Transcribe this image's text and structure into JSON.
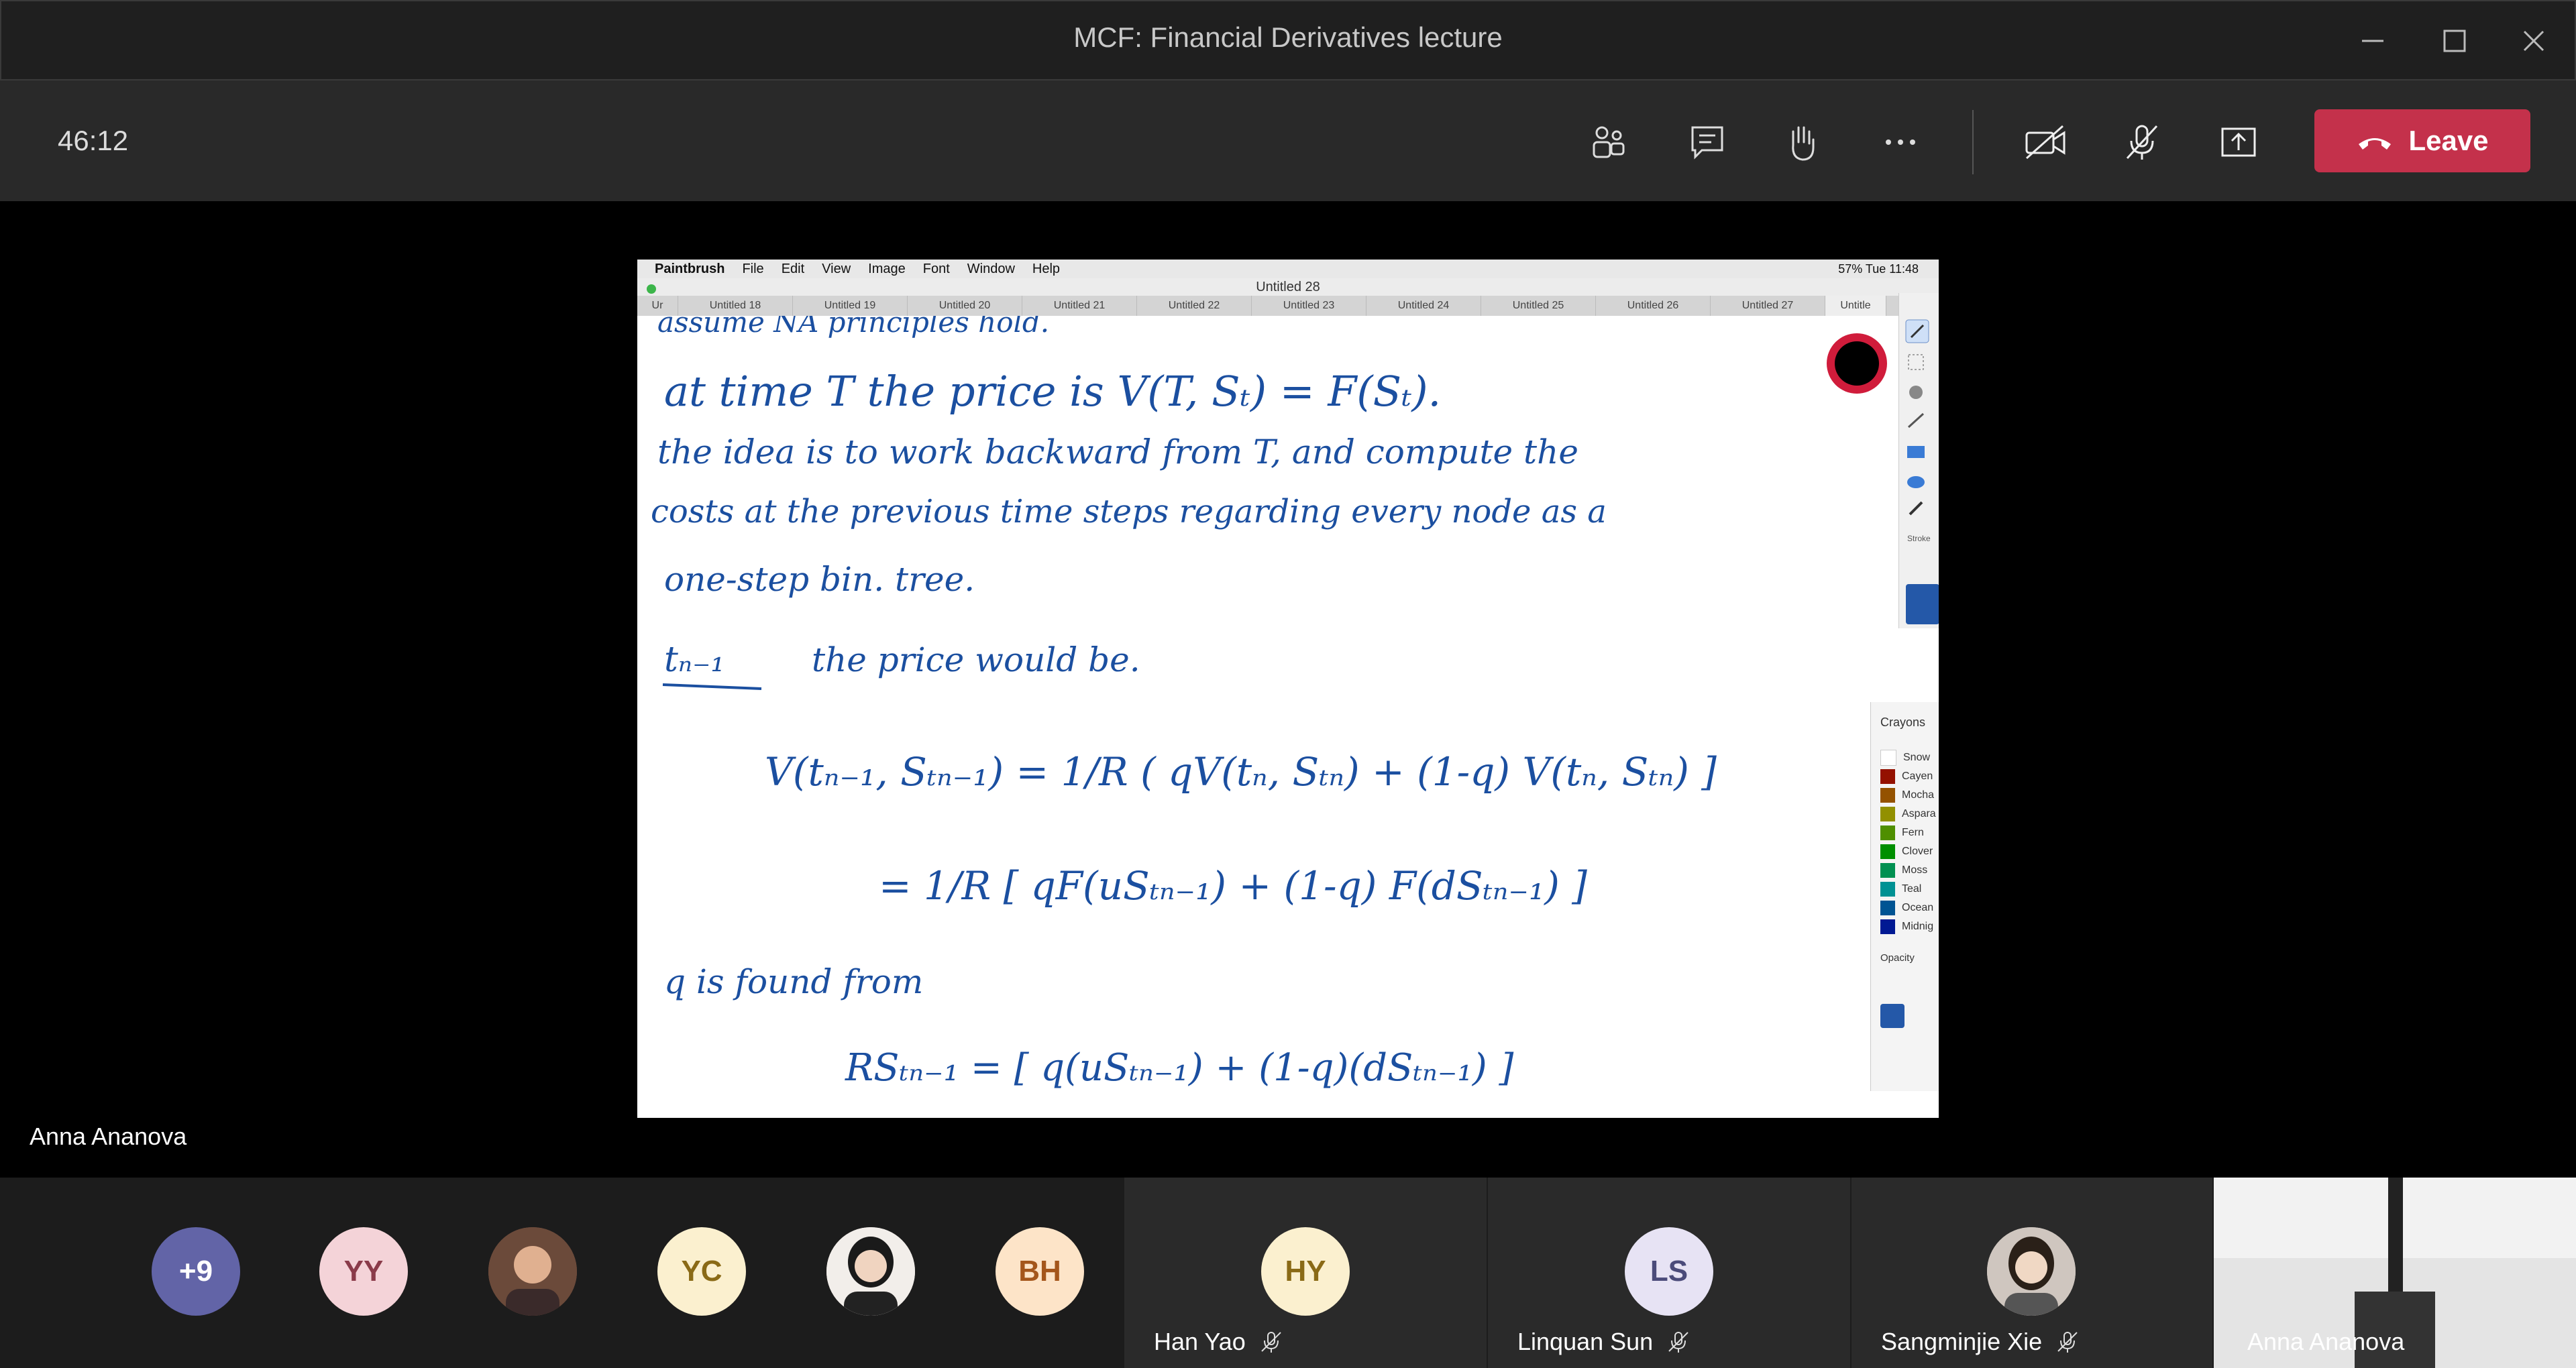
{
  "window": {
    "title": "MCF: Financial Derivatives lecture"
  },
  "toolbar": {
    "timer": "46:12",
    "leave_label": "Leave"
  },
  "presenter": {
    "name": "Anna Ananova"
  },
  "paintbrush": {
    "menu": [
      "Paintbrush",
      "File",
      "Edit",
      "View",
      "Image",
      "Font",
      "Window",
      "Help"
    ],
    "status": "57%  Tue 11:48",
    "doc_title": "Untitled 28",
    "tabs": [
      "Ur",
      "Untitled 18",
      "Untitled 19",
      "Untitled 20",
      "Untitled 21",
      "Untitled 22",
      "Untitled 23",
      "Untitled 24",
      "Untitled 25",
      "Untitled 26",
      "Untitled 27",
      "Untitle"
    ],
    "stroke_label": "Stroke",
    "crayons_label": "Crayons",
    "opacity_label": "Opacity",
    "crayons": [
      {
        "name": "Snow",
        "color": "#ffffff"
      },
      {
        "name": "Cayen",
        "color": "#941100"
      },
      {
        "name": "Mocha",
        "color": "#945200"
      },
      {
        "name": "Aspara",
        "color": "#929000"
      },
      {
        "name": "Fern",
        "color": "#4f8f00"
      },
      {
        "name": "Clover",
        "color": "#008f00"
      },
      {
        "name": "Moss",
        "color": "#009051"
      },
      {
        "name": "Teal",
        "color": "#009193"
      },
      {
        "name": "Ocean",
        "color": "#005493"
      },
      {
        "name": "Midnig",
        "color": "#011993"
      }
    ],
    "handwriting": {
      "l1": "assume NA principles hold.",
      "l2": "at time T the price is V(T, Sₜ) = F(Sₜ).",
      "l3": "the idea is to work backward from T, and compute the",
      "l4": "costs at the previous time steps regarding every node as a",
      "l5": "one-step bin. tree.",
      "l6a": "tₙ₋₁",
      "l6b": "the price would be.",
      "l7": "V(tₙ₋₁, Sₜₙ₋₁) =  1/R ( qV(tₙ, Sₜₙ) + (1-q)  V(tₙ, Sₜₙ) ]",
      "l8": "=  1/R [ qF(uSₜₙ₋₁) + (1-q) F(dSₜₙ₋₁) ]",
      "l9": "q is found from",
      "l10": "RSₜₙ₋₁ = [ q(uSₜₙ₋₁) + (1-q)(dSₜₙ₋₁) ]"
    }
  },
  "participants": [
    {
      "initials": "+9",
      "bg": "#6264a7",
      "fg": "#ffffff"
    },
    {
      "initials": "YY",
      "bg": "#f4d3d8",
      "fg": "#8a3b4a"
    },
    {
      "initials": "",
      "bg": "#8a5a4a",
      "fg": "#ffffff"
    },
    {
      "initials": "YC",
      "bg": "#fbf0cf",
      "fg": "#8a6a16"
    },
    {
      "initials": "",
      "bg": "#e8e0dc",
      "fg": "#ffffff"
    },
    {
      "initials": "BH",
      "bg": "#fde4c8",
      "fg": "#a4561b"
    }
  ],
  "tiles": [
    {
      "initials": "HY",
      "name": "Han Yao",
      "bg": "#fbf0cf",
      "fg": "#8a6a16"
    },
    {
      "initials": "LS",
      "name": "Linquan Sun",
      "bg": "#e7e3f4",
      "fg": "#4b4b7a"
    },
    {
      "initials": "",
      "name": "Sangminjie Xie",
      "bg": "#d9cfc8",
      "fg": "#ffffff"
    },
    {
      "initials": "",
      "name": "Anna Ananova",
      "bg": "#e9e9e9",
      "fg": "#333333"
    }
  ]
}
